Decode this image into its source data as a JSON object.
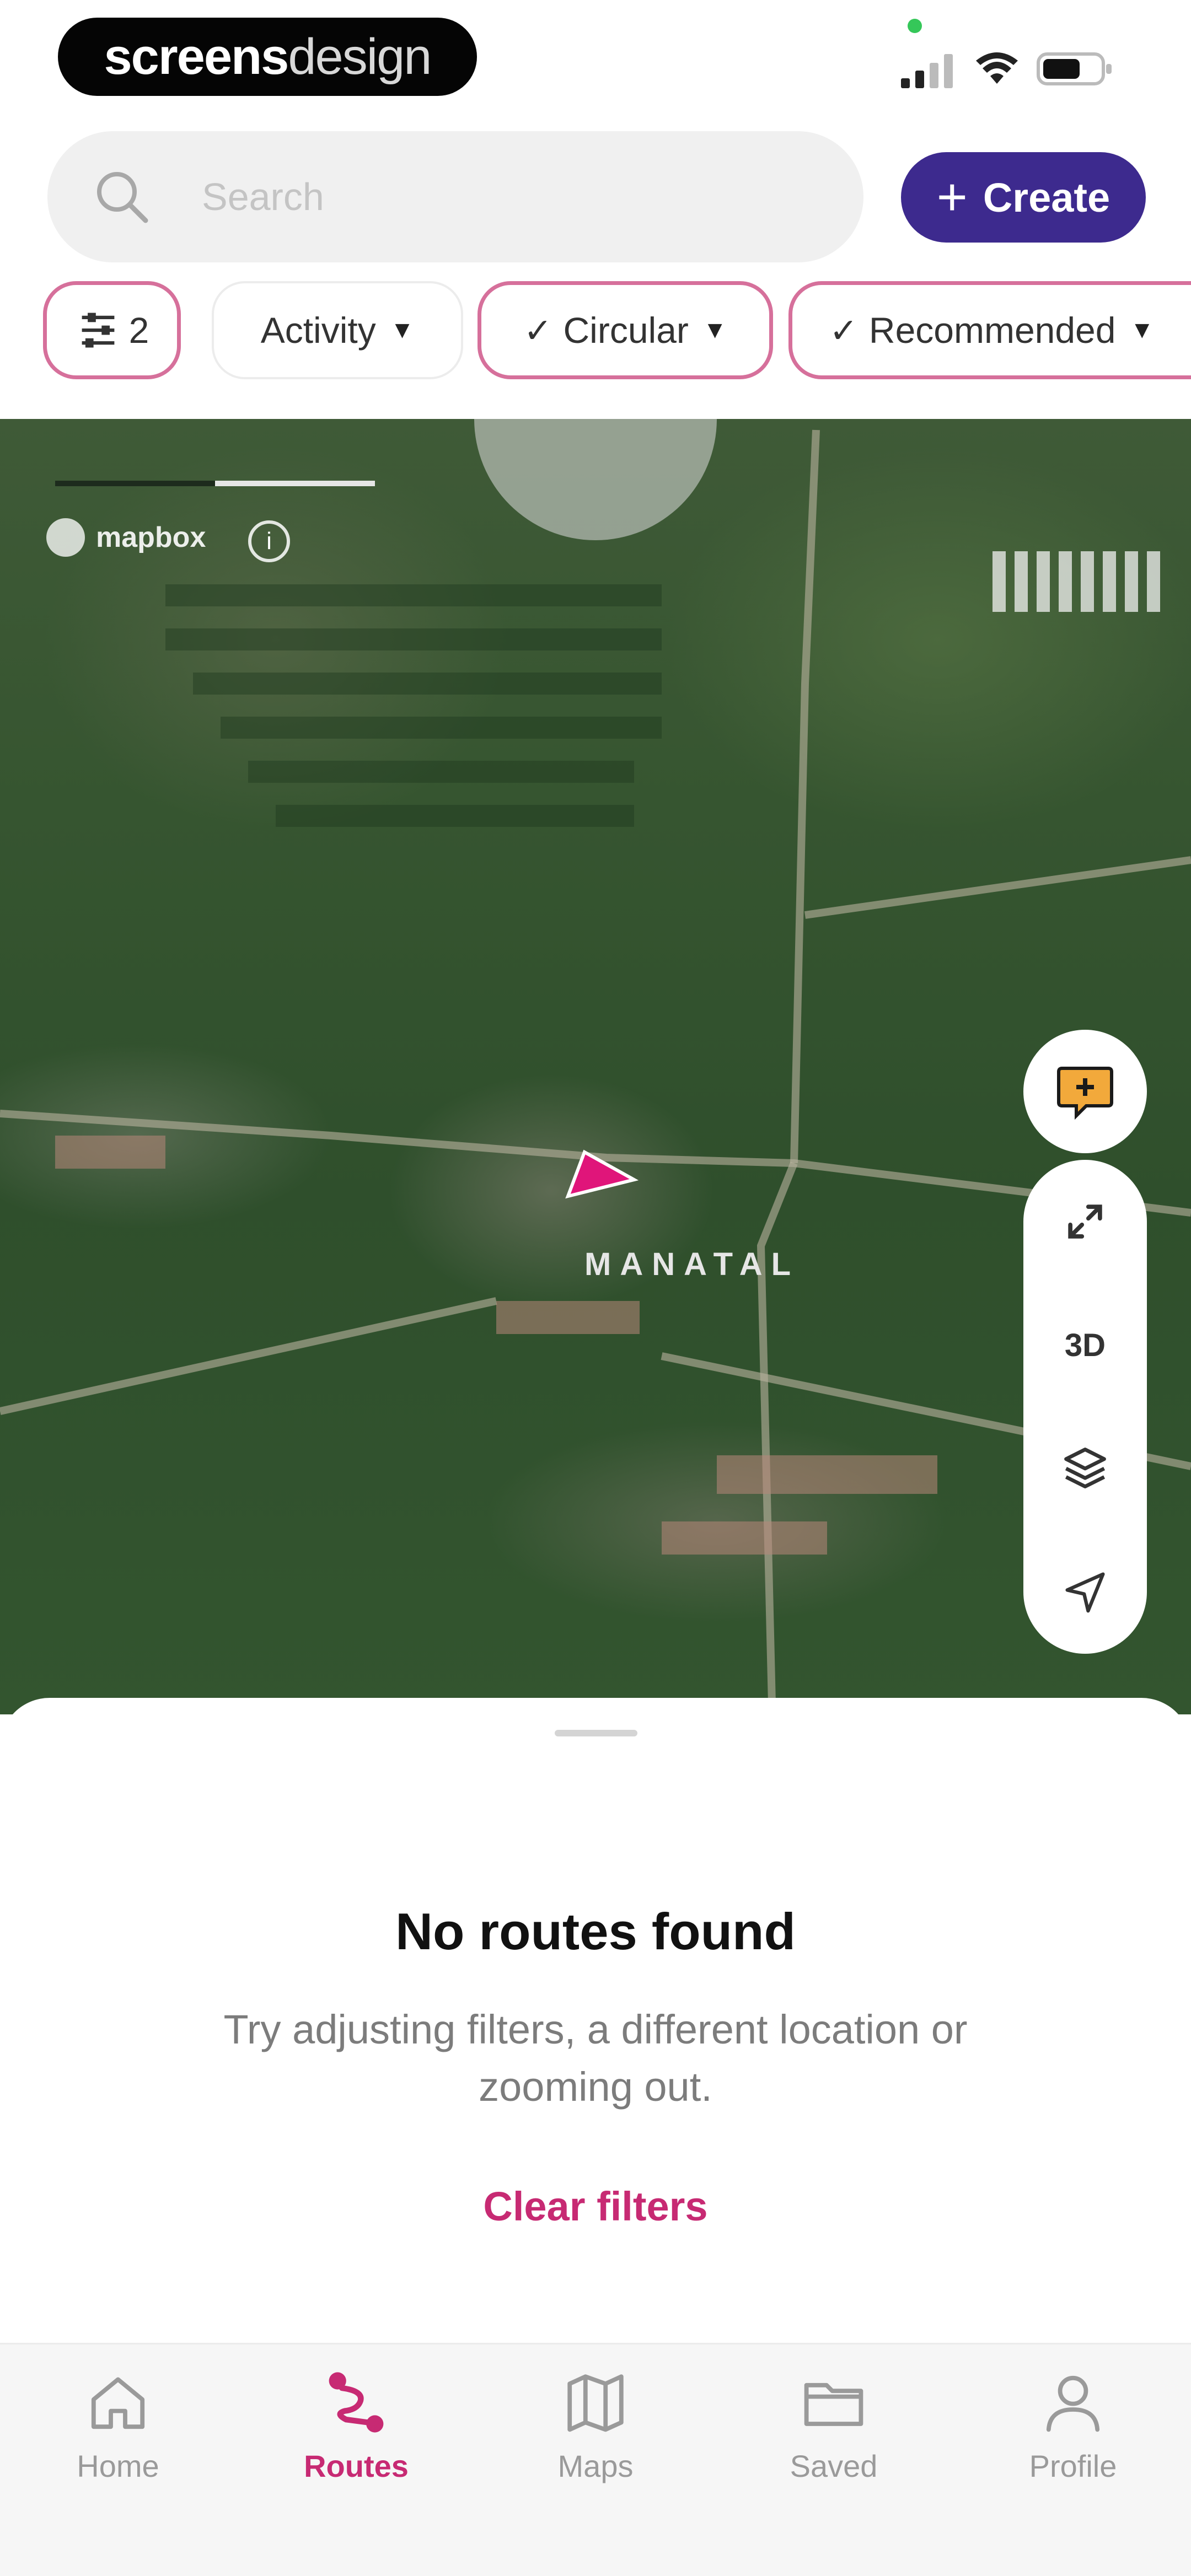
{
  "status_bar": {
    "brand_primary": "screens",
    "brand_secondary": "design"
  },
  "search": {
    "placeholder": "Search",
    "create_label": "Create"
  },
  "filters": {
    "count_chip": "2",
    "chips": [
      {
        "label": "Activity",
        "checked": false
      },
      {
        "label": "Circular",
        "checked": true
      },
      {
        "label": "Recommended",
        "checked": true
      }
    ]
  },
  "map": {
    "attribution": "mapbox",
    "place_label": "MANATAL",
    "controls": {
      "three_d_label": "3D"
    }
  },
  "empty_state": {
    "title": "No routes found",
    "subtitle": "Try adjusting filters, a different location or zooming out.",
    "action": "Clear filters"
  },
  "tabbar": {
    "items": [
      {
        "label": "Home",
        "icon": "home-icon",
        "active": false
      },
      {
        "label": "Routes",
        "icon": "routes-icon",
        "active": true
      },
      {
        "label": "Maps",
        "icon": "map-icon",
        "active": false
      },
      {
        "label": "Saved",
        "icon": "folder-icon",
        "active": false
      },
      {
        "label": "Profile",
        "icon": "profile-icon",
        "active": false
      }
    ]
  },
  "colors": {
    "accent": "#c72a73",
    "create_button": "#3d2a8e",
    "chip_border_active": "#d6709b"
  }
}
